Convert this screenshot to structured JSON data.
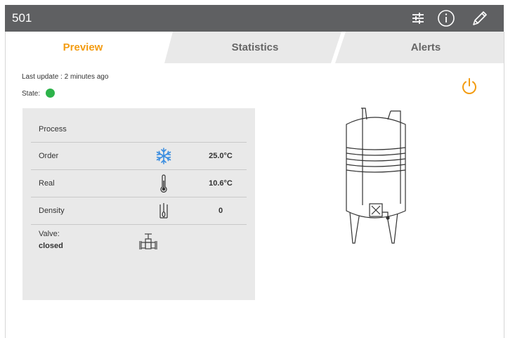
{
  "header": {
    "title": "501",
    "icons": [
      "sliders-icon",
      "info-icon",
      "pencil-icon"
    ]
  },
  "tabs": [
    {
      "label": "Preview",
      "active": true
    },
    {
      "label": "Statistics",
      "active": false
    },
    {
      "label": "Alerts",
      "active": false
    }
  ],
  "colors": {
    "accent": "#f39c12",
    "header_bg": "#5f6062",
    "tab_inactive_bg": "#e9e9e9",
    "state_ok": "#2db34a",
    "snow_blue": "#3a8de0"
  },
  "status": {
    "last_update": "Last update : 2 minutes ago",
    "state_label": "State:"
  },
  "process": {
    "title": "Process",
    "rows": [
      {
        "label": "Order",
        "icon": "snowflake-icon",
        "value": "25.0°C"
      },
      {
        "label": "Real",
        "icon": "thermometer-icon",
        "value": "10.6°C"
      },
      {
        "label": "Density",
        "icon": "hydrometer-icon",
        "value": "0"
      }
    ],
    "valve": {
      "label": "Valve:",
      "value": "closed",
      "icon": "valve-icon"
    }
  }
}
